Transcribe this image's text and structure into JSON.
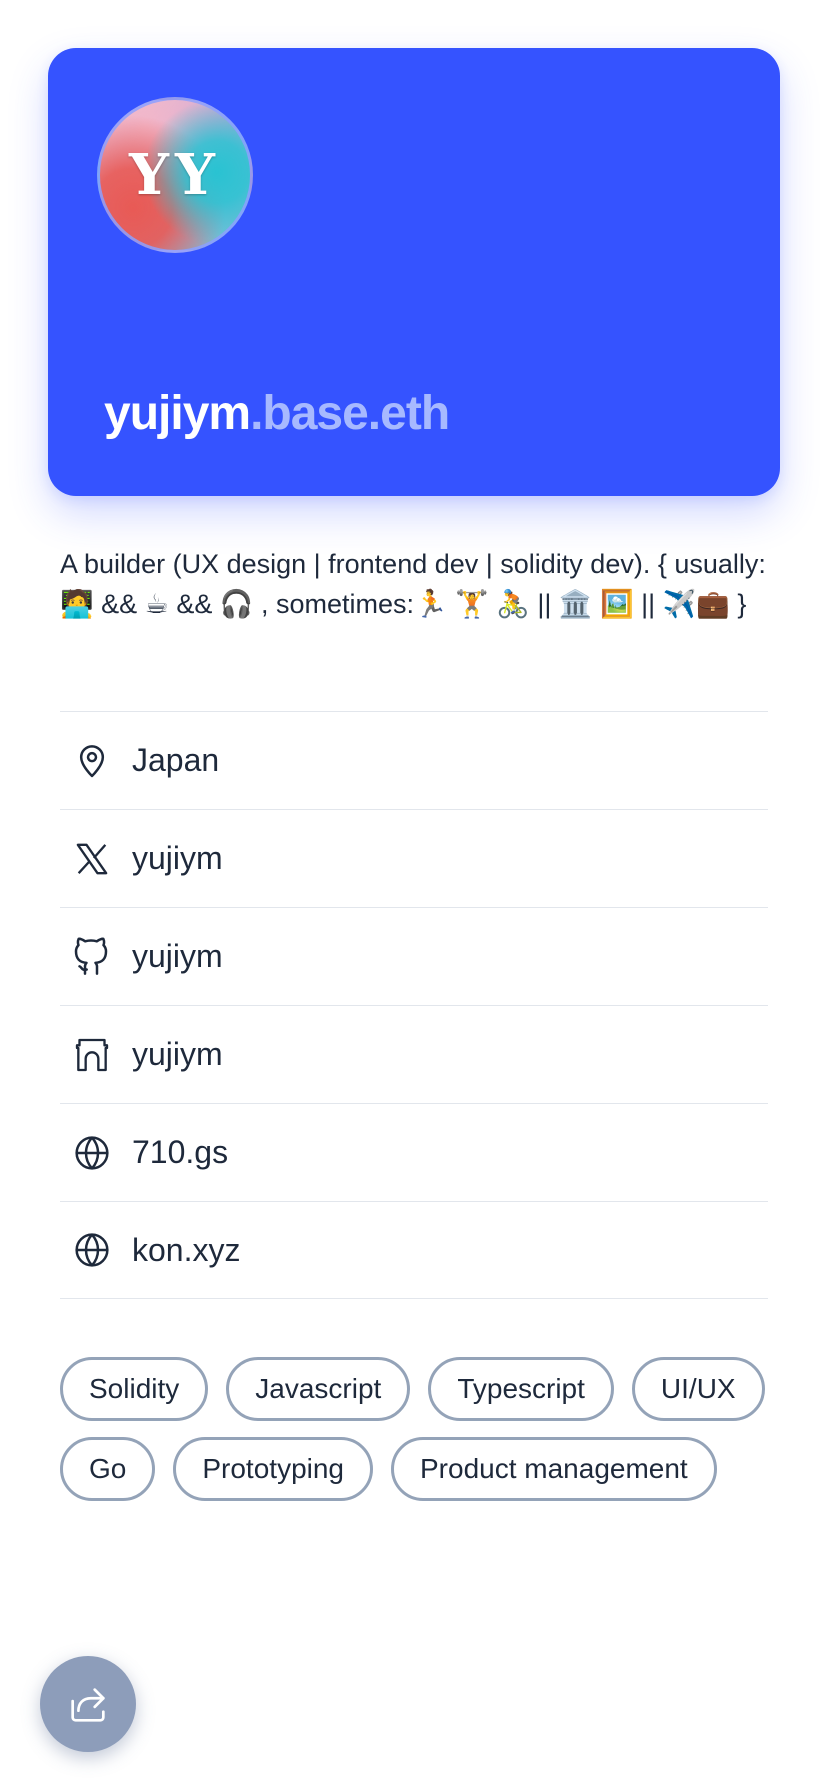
{
  "profile": {
    "avatar_monogram": "YY",
    "username": "yujiym",
    "name_suffix": ".base.eth",
    "bio": "A builder (UX design | frontend dev | solidity dev). { usually:🧑‍💻 && ☕ && 🎧 , sometimes:🏃 🏋️ 🚴 || 🏛️ 🖼️ || ✈️💼 }"
  },
  "links": [
    {
      "icon": "map-pin-icon",
      "text": "Japan"
    },
    {
      "icon": "x-logo-icon",
      "text": "yujiym"
    },
    {
      "icon": "github-icon",
      "text": "yujiym"
    },
    {
      "icon": "farcaster-icon",
      "text": "yujiym"
    },
    {
      "icon": "globe-icon",
      "text": "710.gs"
    },
    {
      "icon": "globe-icon",
      "text": "kon.xyz"
    }
  ],
  "tags": [
    "Solidity",
    "Javascript",
    "Typescript",
    "UI/UX",
    "Go",
    "Prototyping",
    "Product management"
  ],
  "share_button": {
    "icon": "share-icon"
  },
  "colors": {
    "card_bg": "#3553ff",
    "name_suffix": "#a7b9ff",
    "text": "#1e293b",
    "divider": "#e2e6ec",
    "tag_border": "#94a3b8",
    "share_bg": "#8d9dba"
  }
}
